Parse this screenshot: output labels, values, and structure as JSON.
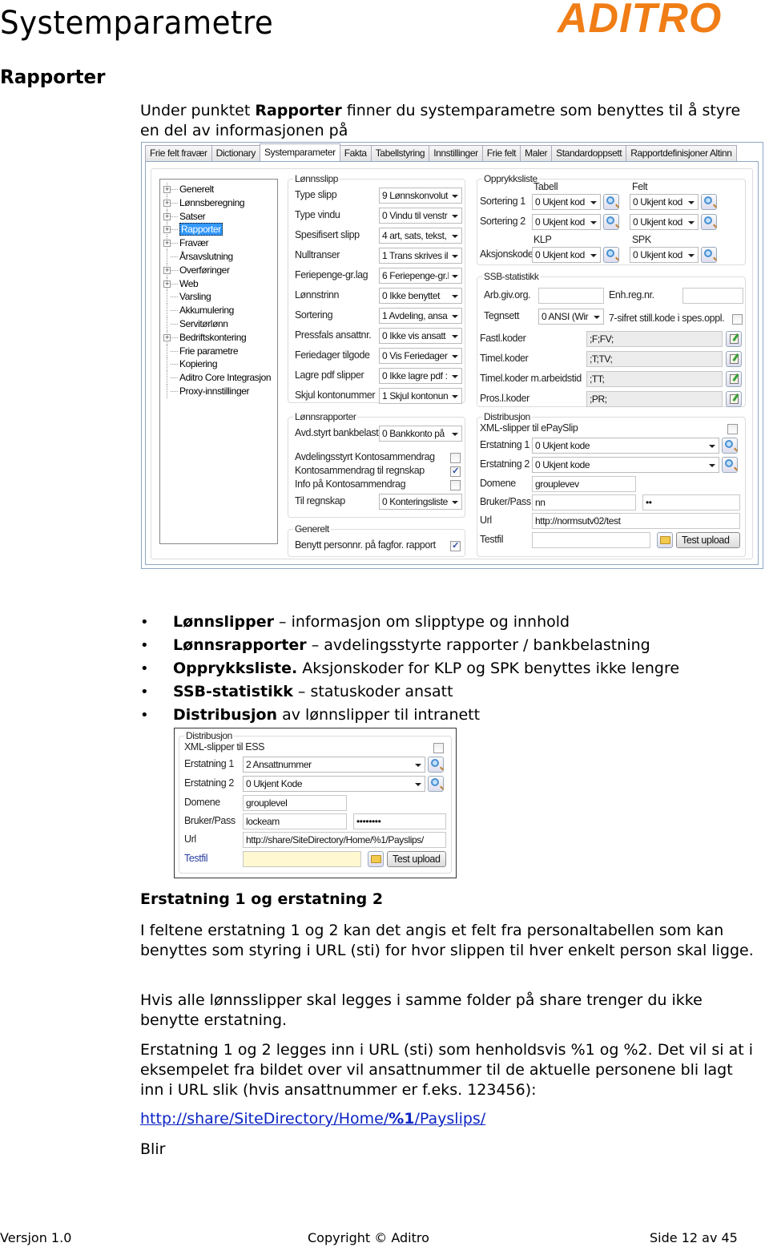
{
  "header": {
    "title": "Systemparametre",
    "logo_text": "ADITRO",
    "logo_color": "#f07d15"
  },
  "section": {
    "title": "Rapporter",
    "intro_prefix": "Under punktet ",
    "intro_bold": "Rapporter",
    "intro_suffix": " finner du systemparametre som benyttes til å styre en del av informasjonen på"
  },
  "app": {
    "tabs": [
      {
        "label": "Frie felt fravær",
        "active": false
      },
      {
        "label": "Dictionary",
        "active": false
      },
      {
        "label": "Systemparameter",
        "active": true
      },
      {
        "label": "Fakta",
        "active": false
      },
      {
        "label": "Tabellstyring",
        "active": false
      },
      {
        "label": "Innstillinger",
        "active": false
      },
      {
        "label": "Frie felt",
        "active": false
      },
      {
        "label": "Maler",
        "active": false
      },
      {
        "label": "Standardoppsett",
        "active": false
      },
      {
        "label": "Rapportdefinisjoner Altinn",
        "active": false
      }
    ],
    "tree": [
      {
        "label": "Generelt",
        "expandable": true,
        "selected": false
      },
      {
        "label": "Lønnsberegning",
        "expandable": true,
        "selected": false
      },
      {
        "label": "Satser",
        "expandable": true,
        "selected": false
      },
      {
        "label": "Rapporter",
        "expandable": true,
        "selected": true
      },
      {
        "label": "Fravær",
        "expandable": true,
        "selected": false
      },
      {
        "label": "Årsavslutning",
        "expandable": false,
        "selected": false
      },
      {
        "label": "Overføringer",
        "expandable": true,
        "selected": false
      },
      {
        "label": "Web",
        "expandable": true,
        "selected": false
      },
      {
        "label": "Varsling",
        "expandable": false,
        "selected": false
      },
      {
        "label": "Akkumulering",
        "expandable": false,
        "selected": false
      },
      {
        "label": "Servitørlønn",
        "expandable": false,
        "selected": false
      },
      {
        "label": "Bedriftskontering",
        "expandable": true,
        "selected": false
      },
      {
        "label": "Frie parametre",
        "expandable": false,
        "selected": false
      },
      {
        "label": "Kopiering",
        "expandable": false,
        "selected": false
      },
      {
        "label": "Aditro Core Integrasjon",
        "expandable": false,
        "selected": false
      },
      {
        "label": "Proxy-innstillinger",
        "expandable": false,
        "selected": false
      }
    ],
    "lonnsslipp": {
      "title": "Lønnsslipp",
      "fields": [
        {
          "label": "Type slipp",
          "value": "9 Lønnskonvolut"
        },
        {
          "label": "Type vindu",
          "value": "0 Vindu til venstr"
        },
        {
          "label": "Spesifisert slipp",
          "value": "4 art, sats, tekst,"
        },
        {
          "label": "Nulltranser",
          "value": "1 Trans skrives il"
        },
        {
          "label": "Feriepenge-gr.lag",
          "value": "6 Feriepenge-gr.l"
        },
        {
          "label": "Lønnstrinn",
          "value": "0 Ikke benyttet"
        },
        {
          "label": "Sortering",
          "value": "1 Avdeling, ansa"
        },
        {
          "label": "Pressfals ansattnr.",
          "value": "0 Ikke vis ansatt"
        },
        {
          "label": "Feriedager tilgode",
          "value": "0 Vis Feriedager"
        },
        {
          "label": "Lagre pdf slipper",
          "value": "0 Ikke lagre pdf :"
        },
        {
          "label": "Skjul kontonummer",
          "value": "1 Skjul kontonun"
        }
      ]
    },
    "lonnsrapporter": {
      "title": "Lønnsrapporter",
      "avd_label": "Avd.styrt bankbelast",
      "avd_value": "0 Bankkonto på",
      "checks": [
        {
          "label": "Avdelingsstyrt Kontosammendrag",
          "checked": false
        },
        {
          "label": "Kontosammendrag til regnskap",
          "checked": true
        },
        {
          "label": "Info på Kontosammendrag",
          "checked": false
        }
      ],
      "regnskap_label": "Til regnskap",
      "regnskap_value": "0 Konteringsliste"
    },
    "generelt": {
      "title": "Generelt",
      "check_label": "Benytt personnr. på fagfor. rapport",
      "checked": true
    },
    "opprykksliste": {
      "title": "Opprykksliste",
      "col1": "Tabell",
      "col2": "Felt",
      "col1b": "KLP",
      "col2b": "SPK",
      "rows": [
        {
          "label": "Sortering 1",
          "v1": "0 Ukjent kod",
          "v2": "0 Ukjent kod"
        },
        {
          "label": "Sortering 2",
          "v1": "0 Ukjent kod",
          "v2": "0 Ukjent kod"
        },
        {
          "label": "Aksjonskode",
          "v1": "0 Ukjent kod",
          "v2": "0 Ukjent kod"
        }
      ]
    },
    "ssb": {
      "title": "SSB-statistikk",
      "arb_label": "Arb.giv.org.",
      "arb_value": "",
      "enh_label": "Enh.reg.nr.",
      "enh_value": "",
      "tegnsett_label": "Tegnsett",
      "tegnsett_value": "0 ANSI (Wir",
      "sifret_label": "7-sifret still.kode i spes.oppl.",
      "sifret_checked": false,
      "codes": [
        {
          "label": "Fastl.koder",
          "value": ";F;FV;"
        },
        {
          "label": "Timel.koder",
          "value": ";T;TV;"
        },
        {
          "label": "Timel.koder m.arbeidstid",
          "value": ";TT;"
        },
        {
          "label": "Pros.l.koder",
          "value": ";PR;"
        }
      ]
    },
    "distribusjon": {
      "title": "Distribusjon",
      "xml_label": "XML-slipper til ePaySlip",
      "xml_checked": false,
      "erst1_label": "Erstatning 1",
      "erst1_value": "0 Ukjent kode",
      "erst2_label": "Erstatning 2",
      "erst2_value": "0 Ukjent kode",
      "domene_label": "Domene",
      "domene_value": "grouplevev",
      "bruker_label": "Bruker/Pass",
      "bruker_value": "nn",
      "pass_value": "••",
      "url_label": "Url",
      "url_value": "http://normsutv02/test",
      "testfil_label": "Testfil",
      "testfil_value": "",
      "test_upload": "Test upload"
    }
  },
  "bullets": [
    {
      "bold": "Lønnslipper",
      "text": " – informasjon om slipptype og innhold"
    },
    {
      "bold": "Lønnsrapporter",
      "text": " – avdelingsstyrte rapporter / bankbelastning"
    },
    {
      "bold": "Opprykksliste.",
      "text": " Aksjonskoder for KLP og SPK benyttes ikke lengre"
    },
    {
      "bold": "SSB-statistikk",
      "text": " – statuskoder ansatt"
    },
    {
      "bold": "Distribusjon",
      "text": " av lønnslipper til intranett"
    }
  ],
  "distribusjon2": {
    "title": "Distribusjon",
    "xml_label": "XML-slipper til ESS",
    "xml_checked": false,
    "erst1_label": "Erstatning 1",
    "erst1_value": "2 Ansattnummer",
    "erst2_label": "Erstatning 2",
    "erst2_value": "0 Ukjent Kode",
    "domene_label": "Domene",
    "domene_value": "grouplevel",
    "bruker_label": "Bruker/Pass",
    "bruker_value": "lockeam",
    "pass_value": "••••••••",
    "url_label": "Url",
    "url_value": "http://share/SiteDirectory/Home/%1/Payslips/",
    "testfil_label": "Testfil",
    "testfil_value": "",
    "test_upload": "Test upload"
  },
  "erstatning": {
    "heading": "Erstatning 1 og erstatning 2",
    "p1": "I feltene erstatning 1 og 2 kan det angis et felt fra personaltabellen som kan benyttes som styring i URL (sti) for hvor slippen til hver enkelt person skal ligge.",
    "p2": "Hvis alle lønnsslipper skal legges i samme folder på share trenger du ikke benytte erstatning.",
    "p3": "Erstatning 1 og 2 legges inn i URL (sti) som henholdsvis %1 og %2. Det vil si at i eksempelet fra bildet over vil ansattnummer til de aktuelle personene bli lagt inn i URL slik (hvis ansattnummer er f.eks. 123456):",
    "link_prefix": "http://share/SiteDirectory/Home/",
    "link_bold": "%1",
    "link_suffix": "/Payslips/",
    "blir": "Blir"
  },
  "footer": {
    "version": "Versjon 1.0",
    "copyright": "Copyright © Aditro",
    "page": "Side 12 av 45"
  }
}
